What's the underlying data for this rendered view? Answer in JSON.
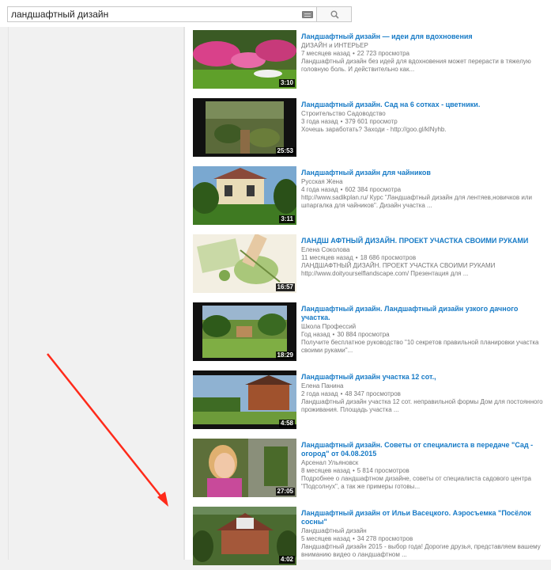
{
  "search": {
    "query": "ландшафтный дизайн",
    "keyboard_icon": "keyboard-icon",
    "search_icon": "magnifier-icon"
  },
  "results": [
    {
      "title": "Ландшафтный дизайн — идеи для вдохновения",
      "channel": "ДИЗАЙН и ИНТЕРЬЕР",
      "age": "7 месяцев назад",
      "views": "22 723 просмотра",
      "desc": "Ландшафтный дизайн без идей для вдохновения может перерасти в тяжелую головную боль. И действительно как...",
      "duration": "3:10"
    },
    {
      "title": "Ландшафтный дизайн. Сад на 6 сотках - цветники.",
      "channel": "Строительство Садоводство",
      "age": "3 года назад",
      "views": "379 601 просмотр",
      "desc": "Хочешь заработать? Заходи - http://goo.gl/klNyhb.",
      "duration": "25:53"
    },
    {
      "title": "Ландшафтный дизайн для чайников",
      "channel": "Русская Жена",
      "age": "4 года назад",
      "views": "602 384 просмотра",
      "desc": "http://www.sadikplan.ru/ Курс \"Ландшафтный дизайн для лентяев,новичков или шпаргалка для чайников\". Дизайн участка ...",
      "duration": "3:11"
    },
    {
      "title": "ЛАНДШ АФТНЫЙ ДИЗАЙН. ПРОЕКТ УЧАСТКА СВОИМИ РУКАМИ",
      "channel": "Елена Соколова",
      "age": "11 месяцев назад",
      "views": "18 686 просмотров",
      "desc": "ЛАНДШАФТНЫЙ ДИЗАЙН. ПРОЕКТ УЧАСТКА СВОИМИ РУКАМИ http://www.doityourselflandscape.com/ Презентация для ...",
      "duration": "16:57"
    },
    {
      "title": "Ландшафтный дизайн. Ландшафтный дизайн узкого дачного участка.",
      "channel": "Школа Профессий",
      "age": "Год назад",
      "views": "30 884 просмотра",
      "desc": "Получите бесплатное руководство \"10 секретов правильной планировки участка своими руками\"...",
      "duration": "18:29"
    },
    {
      "title": "Ландшафтный дизайн участка 12 сот.,",
      "channel": "Елена Панина",
      "age": "2 года назад",
      "views": "48 347 просмотров",
      "desc": "Ландшафтный дизайн участка 12 сот. неправильной формы Дом для постоянного проживания. Площадь участка ...",
      "duration": "4:58"
    },
    {
      "title": "Ландшафтный дизайн. Советы от специалиста в передаче \"Сад - огород\" от 04.08.2015",
      "channel": "Арсенал Ульяновск",
      "age": "8 месяцев назад",
      "views": "5 814 просмотров",
      "desc": "Подробнее о ландшафтном дизайне, советы от специалиста садового центра \"Подсолнух\", а так же примеры готовы...",
      "duration": "27:05"
    },
    {
      "title": "Ландшафтный дизайн от Ильи Васецкого. Аэросъемка \"Посёлок сосны\"",
      "channel": "Ландшафтный дизайн",
      "age": "5 месяцев назад",
      "views": "34 278 просмотров",
      "desc": "Ландшафтный дизайн 2015 - выбор года! Дорогие друзья, представляем вашему вниманию видео о ландшафтном ...",
      "duration": "4:02"
    }
  ],
  "annotation": {
    "arrow_color": "#ff2a1a"
  }
}
